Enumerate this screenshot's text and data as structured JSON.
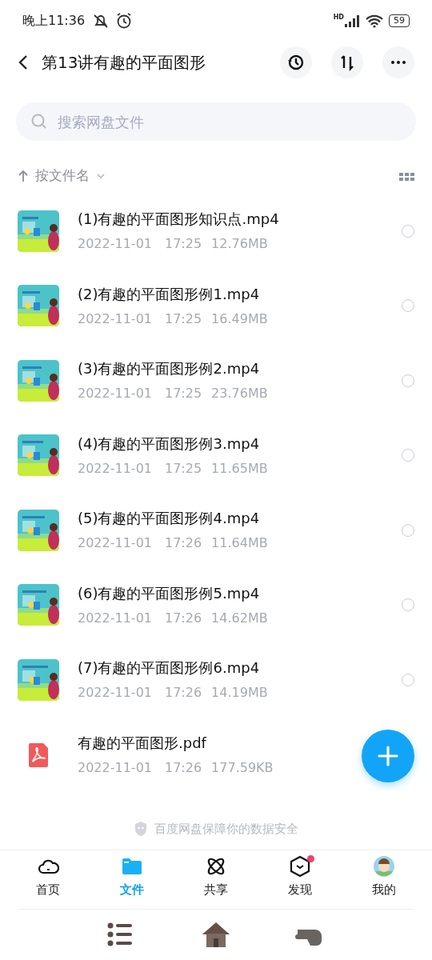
{
  "status_bar": {
    "time": "晚上11:36",
    "signal_label": "HD",
    "battery": "59"
  },
  "header": {
    "title": "第13讲有趣的平面图形"
  },
  "search": {
    "placeholder": "搜索网盘文件"
  },
  "sort": {
    "label": "按文件名"
  },
  "files": [
    {
      "kind": "video",
      "name": "(1)有趣的平面图形知识点.mp4",
      "date": "2022-11-01",
      "time": "17:25",
      "size": "12.76MB",
      "selected": false
    },
    {
      "kind": "video",
      "name": "(2)有趣的平面图形例1.mp4",
      "date": "2022-11-01",
      "time": "17:25",
      "size": "16.49MB",
      "selected": false
    },
    {
      "kind": "video",
      "name": "(3)有趣的平面图形例2.mp4",
      "date": "2022-11-01",
      "time": "17:25",
      "size": "23.76MB",
      "selected": false
    },
    {
      "kind": "video",
      "name": "(4)有趣的平面图形例3.mp4",
      "date": "2022-11-01",
      "time": "17:25",
      "size": "11.65MB",
      "selected": false
    },
    {
      "kind": "video",
      "name": "(5)有趣的平面图形例4.mp4",
      "date": "2022-11-01",
      "time": "17:26",
      "size": "11.64MB",
      "selected": false
    },
    {
      "kind": "video",
      "name": "(6)有趣的平面图形例5.mp4",
      "date": "2022-11-01",
      "time": "17:26",
      "size": "14.62MB",
      "selected": false
    },
    {
      "kind": "video",
      "name": "(7)有趣的平面图形例6.mp4",
      "date": "2022-11-01",
      "time": "17:26",
      "size": "14.19MB",
      "selected": false
    },
    {
      "kind": "pdf",
      "name": "有趣的平面图形.pdf",
      "date": "2022-11-01",
      "time": "17:26",
      "size": "177.59KB"
    }
  ],
  "footer_note": "百度网盘保障你的数据安全",
  "tabs": [
    {
      "kind": "home",
      "label": "首页",
      "selected": false,
      "badge": false
    },
    {
      "kind": "files",
      "label": "文件",
      "selected": true,
      "badge": false
    },
    {
      "kind": "share",
      "label": "共享",
      "selected": false,
      "badge": false
    },
    {
      "kind": "discover",
      "label": "发现",
      "selected": false,
      "badge": true
    },
    {
      "kind": "me",
      "label": "我的",
      "selected": false,
      "badge": false
    }
  ]
}
